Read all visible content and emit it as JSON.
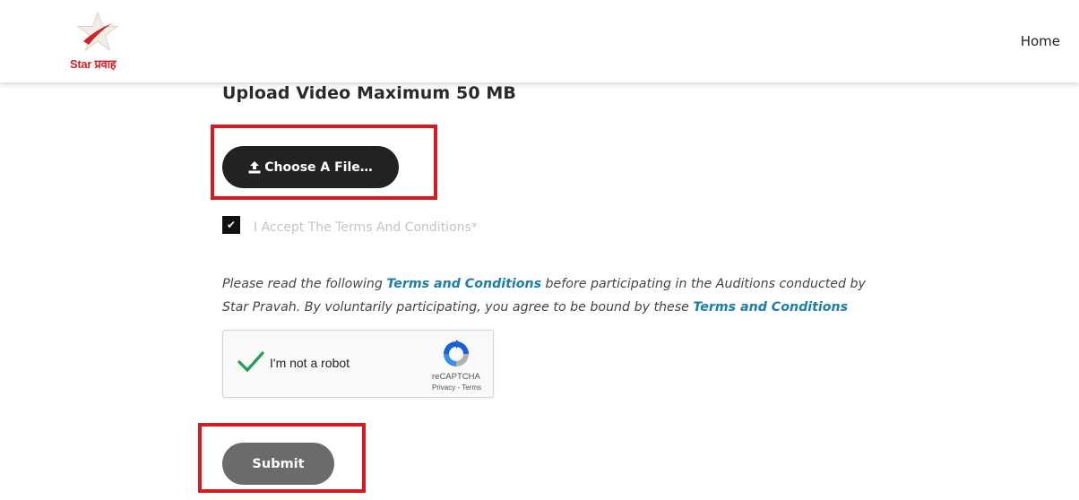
{
  "header": {
    "logo_text": "Star प्रवाह",
    "nav_home": "Home"
  },
  "upload": {
    "title": "Upload Video Maximum 50 MB",
    "choose_label": "Choose A File…",
    "choose_icon": "upload-icon"
  },
  "terms": {
    "checkbox_checked": true,
    "accept_label": "I Accept The Terms And Conditions*",
    "para_part1": "Please read the following ",
    "link1": "Terms and Conditions",
    "para_part2": " before participating in the Auditions conducted by Star Pravah. By voluntarily participating, you agree to be bound by these ",
    "link2": "Terms and Conditions"
  },
  "recaptcha": {
    "label": "I'm not a robot",
    "brand": "reCAPTCHA",
    "privacy": "Privacy",
    "sep": " - ",
    "terms": "Terms",
    "checked": true
  },
  "form": {
    "submit_label": "Submit"
  },
  "colors": {
    "highlight": "#d71920",
    "button_dark": "#222222",
    "submit_gray": "#6b6b6b",
    "link": "#1a7fa8",
    "brand_red": "#d1232a"
  }
}
